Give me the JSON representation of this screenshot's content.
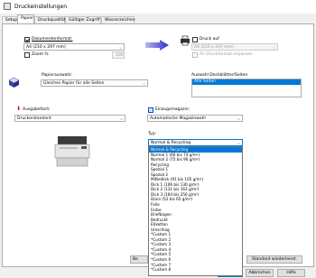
{
  "window": {
    "title": "Druckeinstellungen"
  },
  "tabs": [
    {
      "label": "Setup"
    },
    {
      "label": "Papier"
    },
    {
      "label": "Druckqualität"
    },
    {
      "label": "Gültiger Zugriff"
    },
    {
      "label": "Wasserzeichen"
    }
  ],
  "document_format": {
    "label": "Dokumentenformat:",
    "value": "A4 (210 x 297 mm)",
    "checked": true
  },
  "zoom": {
    "label": "Zoom %",
    "value": "100",
    "checked": false
  },
  "print_on": {
    "label": "Druck auf",
    "value": "A4 (210 x 297 mm)",
    "fit_label": "An Druckformat anpassen",
    "checked": false
  },
  "paper_selection": {
    "label": "Papierauswahl:",
    "value": "Gleiches Papier für alle Seiten"
  },
  "cover_pages": {
    "label": "Auswahl Deckblätter/Seiten",
    "selected": "Alle Seiten"
  },
  "output_tray": {
    "label": "Ausgabefach:",
    "value": "Druckerstandard"
  },
  "input_tray": {
    "label": "Einzugsmagazin:",
    "value": "Automatische Magazinwahl"
  },
  "type": {
    "label": "Typ:",
    "value": "Normal & Recycling"
  },
  "type_options": [
    "Normal & Recycling",
    "Normal 1 (66 bis 74 g/m²)",
    "Normal 2 (75 bis 90 g/m²)",
    "Recycling",
    "Spezial 1",
    "Spezial 2",
    "Mitteldick (91 bis 105 g/m²)",
    "Dick 1 (106 bis 130 g/m²)",
    "Dick 2 (131 bis 163 g/m²)",
    "Dick 3 (164 bis 256 g/m²)",
    "Dünn (52 bis 65 g/m²)",
    "Folie",
    "Farbe",
    "Briefbogen",
    "Bedruckt",
    "Etiketten",
    "Umschlag",
    "*Custom 1",
    "*Custom 2",
    "*Custom 3",
    "*Custom 4",
    "*Custom 5",
    "*Custom 6",
    "*Custom 7",
    "*Custom 8"
  ],
  "buttons": {
    "partial_left": "Be",
    "restore_defaults": "Standard wiederherst.",
    "ok": "OK",
    "cancel": "Abbrechen",
    "help": "Hilfe"
  },
  "colors": {
    "accent": "#0078d7"
  }
}
